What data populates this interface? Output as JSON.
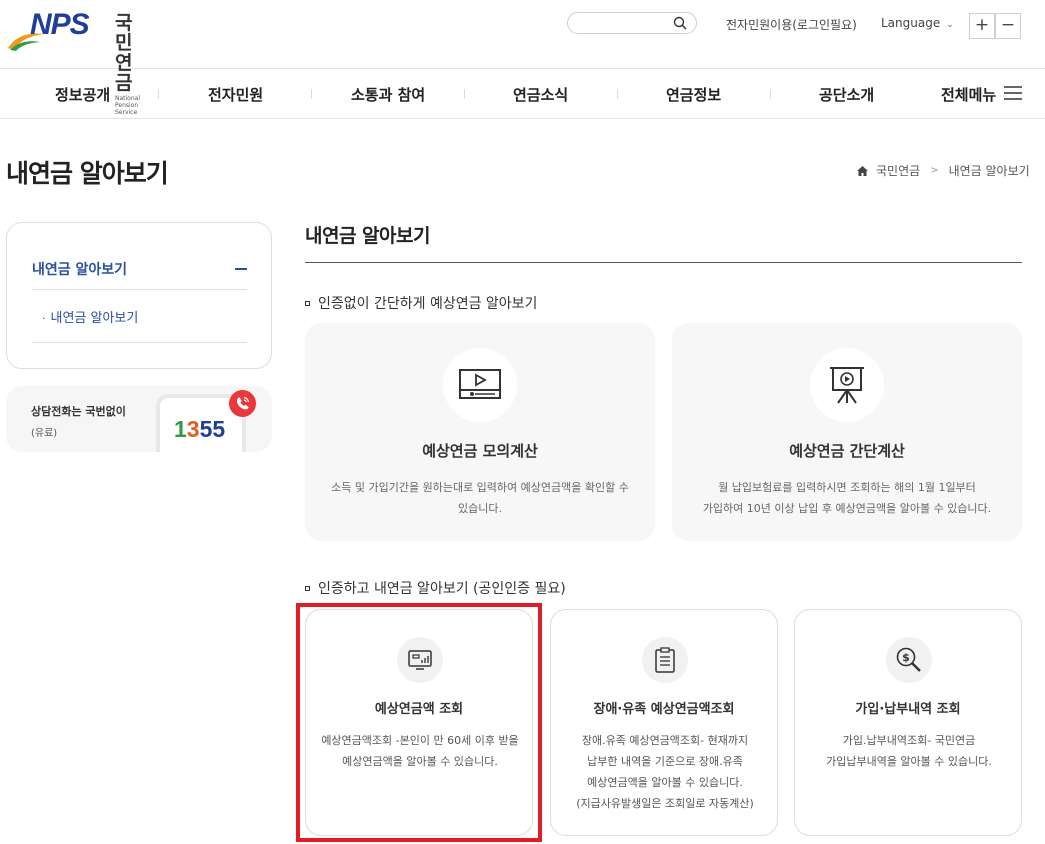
{
  "header": {
    "logo_text": "NPS",
    "logo_ko": "국민연금",
    "logo_en": "National Pension Service",
    "search_placeholder": "",
    "eservice_link": "전자민원이용(로그인필요)",
    "language": "Language",
    "zoom_in": "+",
    "zoom_out": "−"
  },
  "nav": {
    "items": [
      "정보공개",
      "전자민원",
      "소통과 참여",
      "연금소식",
      "연금정보",
      "공단소개",
      "전체메뉴"
    ]
  },
  "page": {
    "title": "내연금 알아보기",
    "breadcrumb": [
      "국민연금",
      "내연금 알아보기"
    ]
  },
  "sidebar": {
    "title": "내연금 알아보기",
    "sub_items": [
      "내연금 알아보기"
    ],
    "phone": {
      "line1": "상담전화는 국번없이",
      "line2": "(유료)",
      "number": [
        "1",
        "3",
        "5",
        "5"
      ]
    }
  },
  "content": {
    "title": "내연금 알아보기",
    "section1": {
      "heading": "인증없이 간단하게 예상연금 알아보기",
      "cards": [
        {
          "title": "예상연금 모의계산",
          "desc": [
            "소득 및 가입기간을 원하는대로 입력하여 예상연금액을 확인할 수",
            "있습니다."
          ],
          "icon": "video-play-icon"
        },
        {
          "title": "예상연금 간단계산",
          "desc": [
            "월 납입보험료를 입력하시면 조회하는 해의 1월 1일부터",
            "가입하여 10년 이상 납입 후 예상연금액을 알아볼 수 있습니다."
          ],
          "icon": "presentation-play-icon"
        }
      ]
    },
    "section2": {
      "heading": "인증하고 내연금 알아보기 (공인인증 필요)",
      "cards": [
        {
          "title": "예상연금액 조회",
          "desc": [
            "예상연금액조회 -본인이 만 60세 이후 받을",
            "예상연금액을 알아볼 수 있습니다."
          ],
          "icon": "monitor-chart-icon"
        },
        {
          "title": "장애·유족 예상연금액조회",
          "desc": [
            "장애.유족 예상연금액조회- 현재까지",
            "납부한 내역을 기준으로 장애.유족",
            "예상연금액을 알아볼 수 있습니다.",
            "(지급사유발생일은 조회일로 자동계산)"
          ],
          "icon": "document-list-icon"
        },
        {
          "title": "가입·납부내역 조회",
          "desc": [
            "가입.납부내역조회- 국민연금",
            "가입납부내역을 알아볼 수 있습니다."
          ],
          "icon": "money-search-icon"
        }
      ]
    }
  },
  "colors": {
    "brand_blue": "#1f3d99",
    "accent_blue": "#2b4ea2",
    "highlight_red": "#e21c24"
  }
}
